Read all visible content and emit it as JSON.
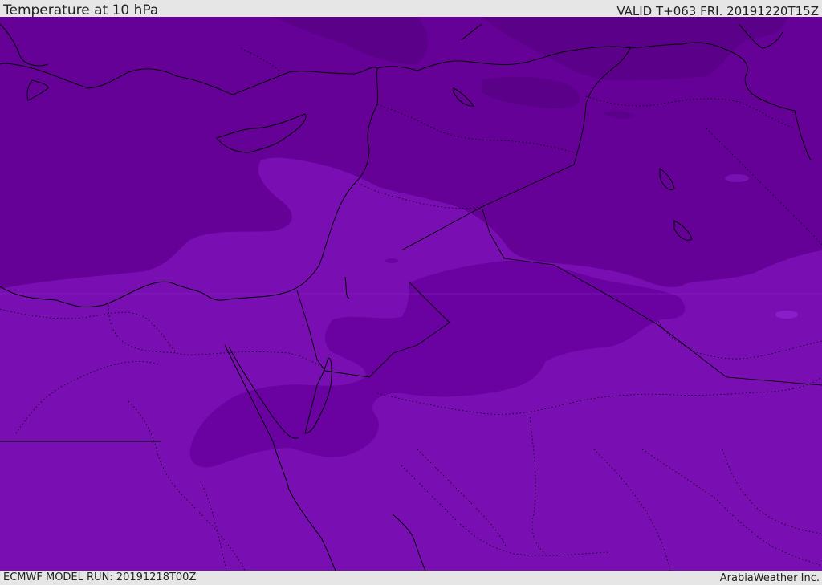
{
  "header": {
    "title": "Temperature at 10 hPa",
    "valid": "VALID T+063 FRI. 20191220T15Z"
  },
  "footer": {
    "model_run": "ECMWF MODEL RUN: 20191218T00Z",
    "credit": "ArabiaWeather Inc."
  },
  "map": {
    "field": "temperature",
    "level": "10 hPa",
    "colors": {
      "darkest": "#5b0189",
      "dark": "#650196",
      "medium": "#7612b0",
      "light": "#790fb3",
      "spot": "#8a1ec8",
      "coastline": "#000000"
    }
  }
}
